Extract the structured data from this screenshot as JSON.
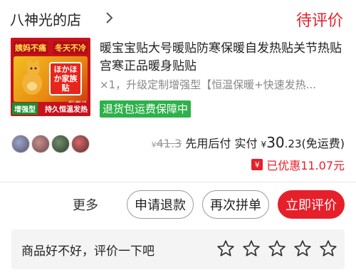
{
  "header": {
    "shop_name": "八神光的店",
    "shop_chevron_icon": "chevron-right-icon",
    "status": "待评价",
    "status_color": "#e6202b"
  },
  "product": {
    "thumbnail": {
      "banner_left": "姨妈不痛",
      "banner_right": "冬天不冷",
      "brand_text": "ほかほか家族",
      "brand_sub": "贴",
      "badge_left": "增强型",
      "badge_right": "持久恒温发热",
      "note": "批发价"
    },
    "title": "暖宝宝贴大号暖贴防寒保暖自发热贴关节热贴宫寒正品暖身贴贴",
    "spec": "×1，升级定制增强型【恒温保暖+快速发热...",
    "guarantee": "退货包运费保障中",
    "guarantee_color": "#2eb14a"
  },
  "pricing": {
    "original_symbol": "¥",
    "original_price": "41.3",
    "label_pay_later": "先用后付",
    "label_actual": "实付",
    "currency": "¥",
    "amount_int": "30",
    "amount_dec": ".23",
    "shipping_note": "(免运费)",
    "discount_icon": "yen-badge-icon",
    "discount_text": "已优惠11.07元"
  },
  "actions": {
    "more": "更多",
    "refund": "申请退款",
    "regroup": "再次拼单",
    "review": "立即评价"
  },
  "review_prompt": {
    "text": "商品好不好，评价一下吧",
    "star_icon": "star-outline-icon",
    "star_count": 5
  }
}
